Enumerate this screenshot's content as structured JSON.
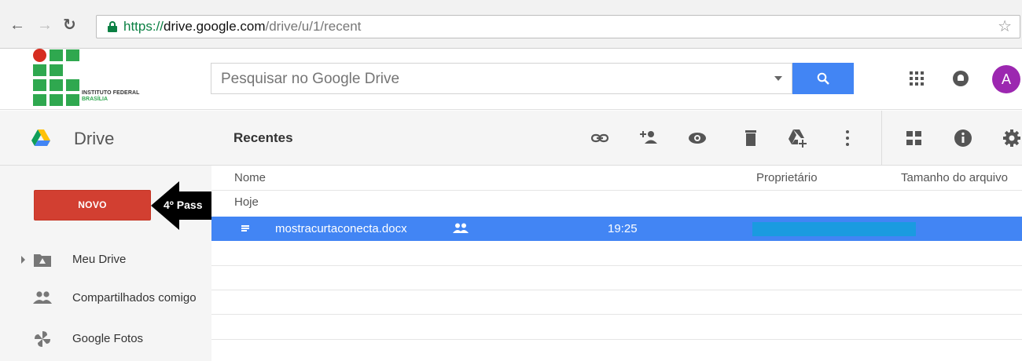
{
  "browser": {
    "url_scheme": "https://",
    "url_host": "drive.google.com",
    "url_path": "/drive/u/1/recent",
    "icons": [
      "back-arrow-icon",
      "forward-arrow-icon",
      "reload-icon",
      "lock-icon",
      "bookmark-star-icon"
    ]
  },
  "header": {
    "logo_line1": "INSTITUTO FEDERAL",
    "logo_line2": "BRASÍLIA",
    "search_placeholder": "Pesquisar no Google Drive",
    "avatar_initial": "A",
    "icons": [
      "search-icon",
      "apps-grid-icon",
      "notifications-icon"
    ]
  },
  "toolbar": {
    "app_title": "Drive",
    "section_title": "Recentes",
    "icons": [
      "get-link-icon",
      "share-icon",
      "preview-icon",
      "delete-icon",
      "add-to-drive-icon",
      "more-vert-icon",
      "grid-view-icon",
      "info-icon",
      "settings-icon"
    ]
  },
  "sidebar": {
    "new_button": "NOVO",
    "callout": "4º Pass",
    "items": [
      {
        "label": "Meu Drive",
        "icon": "my-drive-icon"
      },
      {
        "label": "Compartilhados comigo",
        "icon": "shared-with-me-icon"
      },
      {
        "label": "Google Fotos",
        "icon": "google-photos-icon"
      }
    ]
  },
  "files": {
    "columns": [
      "Nome",
      "Proprietário",
      "Tamanho do arquivo"
    ],
    "group": "Hoje",
    "rows": [
      {
        "name": "mostracurtaconecta.docx",
        "time": "19:25",
        "shared": true
      }
    ]
  },
  "colors": {
    "accent_blue": "#4285f4",
    "new_button_red": "#d23f31",
    "logo_green": "#2fa84f",
    "logo_red": "#d62d20",
    "avatar_purple": "#9c27b0"
  }
}
